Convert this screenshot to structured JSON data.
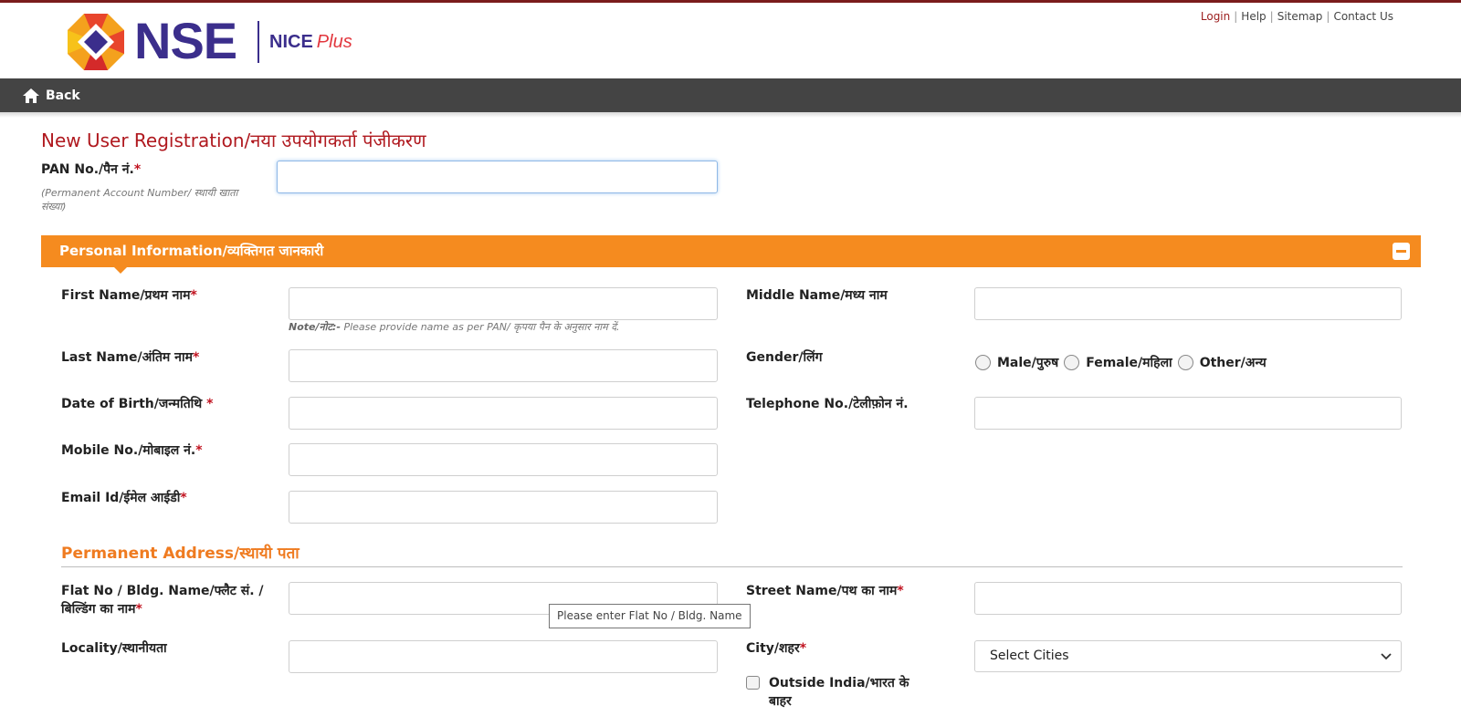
{
  "header": {
    "logo_text": "NSE",
    "logo_product": "NICE",
    "logo_product_suffix": "Plus",
    "links": [
      "Login",
      "Help",
      "Sitemap",
      "Contact Us"
    ]
  },
  "nav": {
    "back_label": "Back"
  },
  "page": {
    "title": "New User Registration/नया उपयोगकर्ता पंजीकरण"
  },
  "pan": {
    "label": "PAN No./पैन नं.",
    "required_mark": "*",
    "hint": "(Permanent Account Number/ स्थायी खाता संख्या)",
    "value": ""
  },
  "personal": {
    "section_title": "Personal Information/व्यक्तिगत जानकारी",
    "first_name_label": "First Name/प्रथम नाम",
    "middle_name_label": "Middle Name/मध्य नाम",
    "note_prefix": "Note/नोट:-",
    "note_text": " Please provide name as per PAN/ कृपया पैन के अनुसार नाम दें.",
    "last_name_label": "Last Name/अंतिम नाम",
    "gender_label": "Gender/लिंग",
    "gender_options": [
      "Male/पुरुष",
      "Female/महिला",
      "Other/अन्य"
    ],
    "dob_label": "Date of Birth/जन्मतिथि ",
    "telephone_label": "Telephone No./टेलीफ़ोन नं.",
    "mobile_label": "Mobile No./मोबाइल नं.",
    "email_label": "Email Id/ईमेल आईडी",
    "required_mark": "*"
  },
  "address": {
    "section_title": "Permanent Address/स्थायी पता",
    "flat_label_line1": "Flat No / Bldg. Name/फ्लैट सं. /",
    "flat_label_line2": "बिल्डिंग का नाम",
    "street_label": "Street Name/पथ का नाम",
    "locality_label": "Locality/स्थानीयता",
    "city_label": "City/शहर",
    "city_selected": "Select Cities",
    "outside_india_label": "Outside India/भारत के बाहर",
    "tooltip": "Please enter Flat No / Bldg. Name",
    "required_mark": "*"
  },
  "colors": {
    "brand_purple": "#3b2e8c",
    "brand_red": "#b0191f",
    "section_orange": "#f58b1f",
    "nav_dark": "#444444"
  }
}
